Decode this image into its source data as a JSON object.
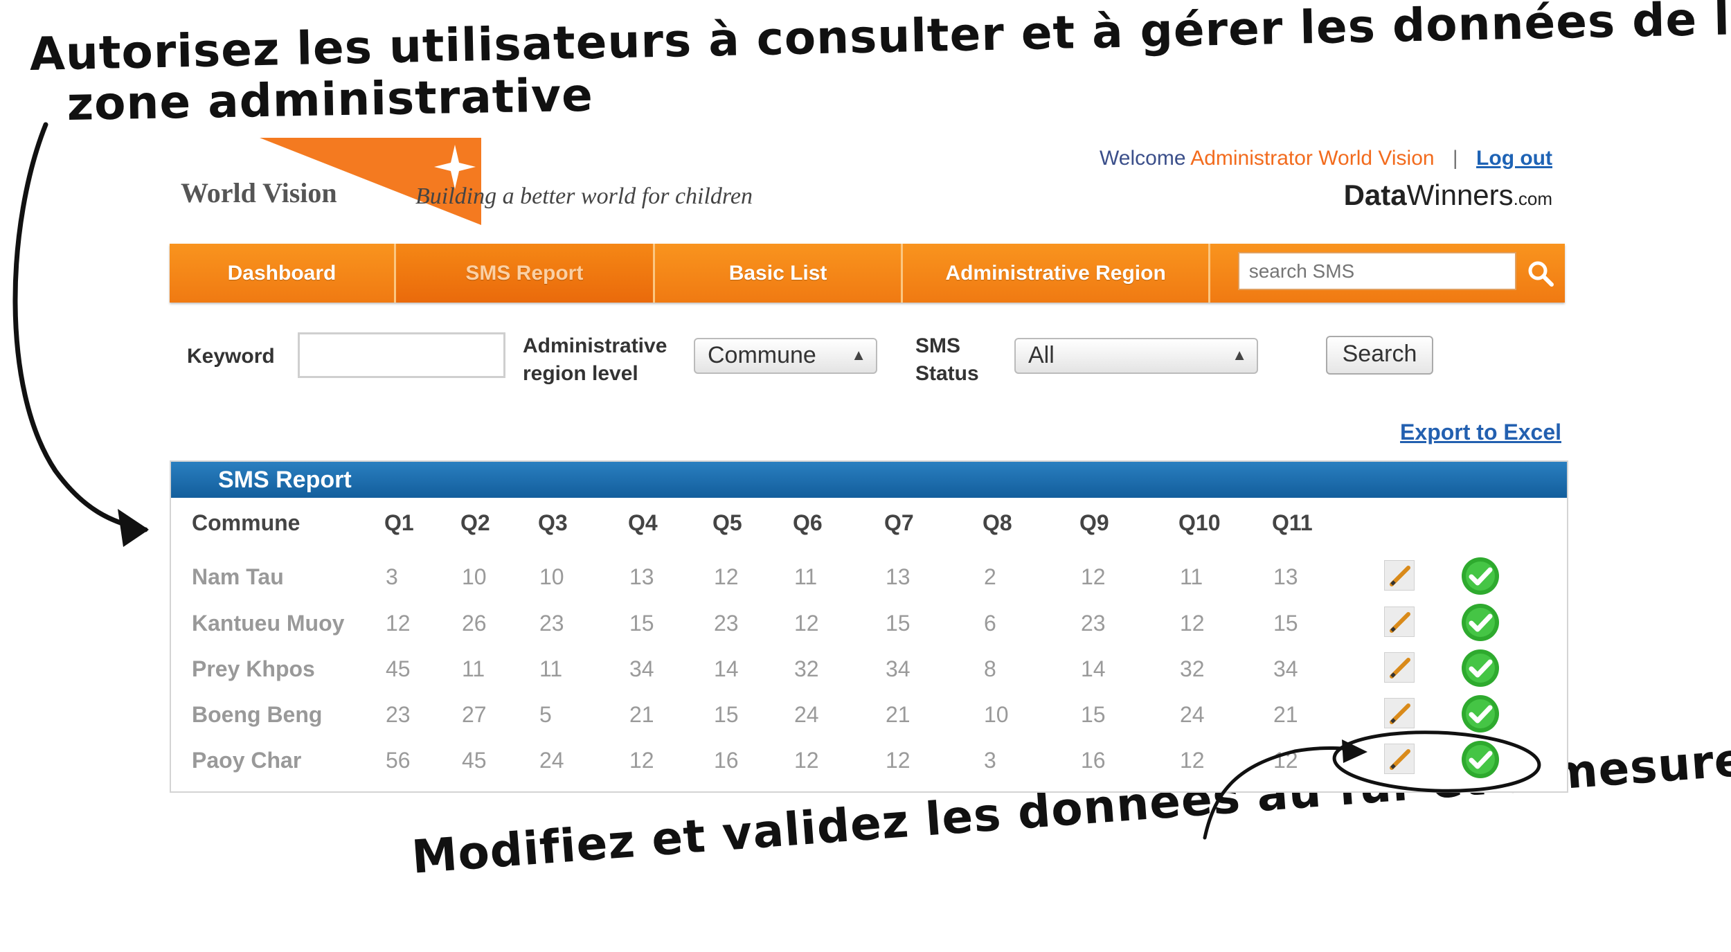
{
  "annotations": {
    "top_line1": "Autorisez les utilisateurs à consulter et à gérer les données de leur",
    "top_line2": "zone administrative",
    "bottom": "Modifiez et validez les données au fur et à mesure de leur arrivée"
  },
  "header": {
    "logo": "World Vision",
    "tagline": "Building a better world for children",
    "welcome_prefix": "Welcome",
    "user": "Administrator World Vision",
    "separator": "|",
    "logout": "Log out",
    "brand_bold": "Data",
    "brand_rest": "Winners",
    "brand_suffix": ".com"
  },
  "nav": {
    "tabs": [
      "Dashboard",
      "SMS Report",
      "Basic List",
      "Administrative Region"
    ],
    "active_tab": "SMS Report",
    "search_placeholder": "search SMS"
  },
  "filters": {
    "keyword_label": "Keyword",
    "keyword_value": "",
    "region_label_1": "Administrative",
    "region_label_2": "region level",
    "region_selected": "Commune",
    "status_label_1": "SMS",
    "status_label_2": "Status",
    "status_selected": "All",
    "search_button": "Search",
    "export_link": "Export to Excel"
  },
  "report": {
    "title": "SMS Report",
    "columns": [
      "Commune",
      "Q1",
      "Q2",
      "Q3",
      "Q4",
      "Q5",
      "Q6",
      "Q7",
      "Q8",
      "Q9",
      "Q10",
      "Q11"
    ],
    "rows": [
      {
        "commune": "Nam Tau",
        "values": [
          "3",
          "10",
          "10",
          "13",
          "12",
          "11",
          "13",
          "2",
          "12",
          "11",
          "13"
        ]
      },
      {
        "commune": "Kantueu Muoy",
        "values": [
          "12",
          "26",
          "23",
          "15",
          "23",
          "12",
          "15",
          "6",
          "23",
          "12",
          "15"
        ]
      },
      {
        "commune": "Prey Khpos",
        "values": [
          "45",
          "11",
          "11",
          "34",
          "14",
          "32",
          "34",
          "8",
          "14",
          "32",
          "34"
        ]
      },
      {
        "commune": "Boeng Beng",
        "values": [
          "23",
          "27",
          "5",
          "21",
          "15",
          "24",
          "21",
          "10",
          "15",
          "24",
          "21"
        ]
      },
      {
        "commune": "Paoy Char",
        "values": [
          "56",
          "45",
          "24",
          "12",
          "16",
          "12",
          "12",
          "3",
          "16",
          "12",
          "12"
        ]
      }
    ]
  },
  "colors": {
    "nav_orange": "#f58a18",
    "report_blue": "#1b6aa8",
    "link_blue": "#2360b0",
    "accent_orange": "#f26b1d",
    "check_green": "#2eaa2e"
  }
}
